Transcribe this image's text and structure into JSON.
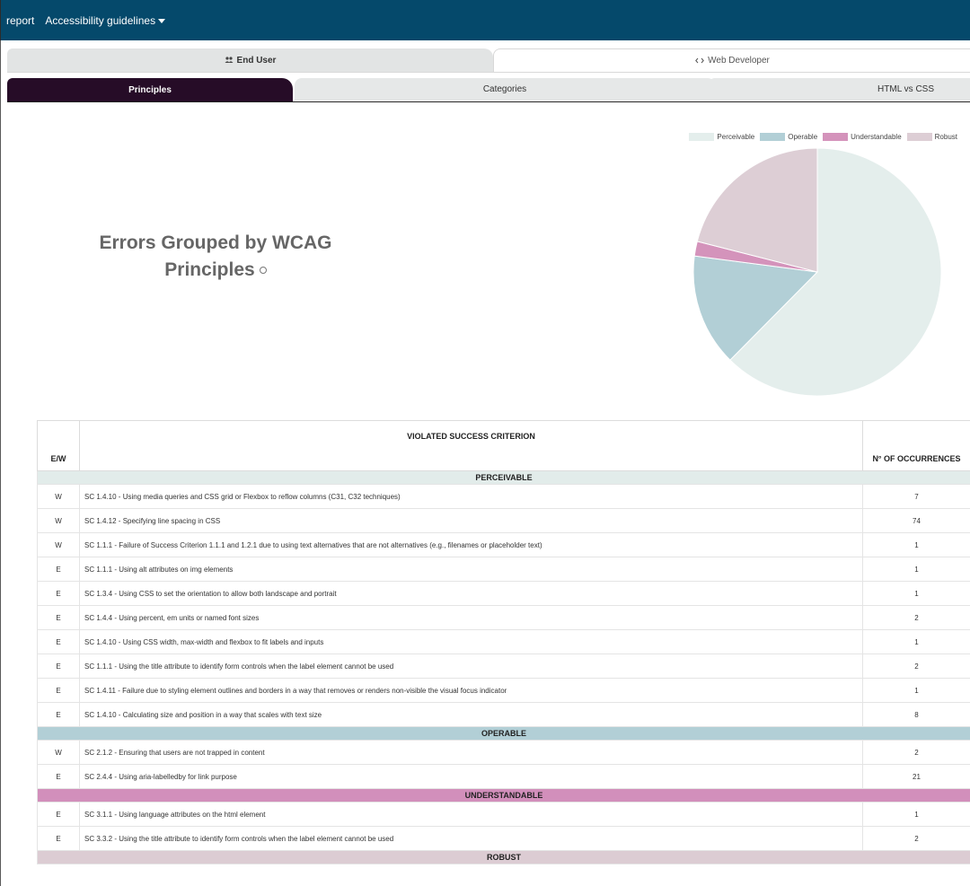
{
  "navbar": {
    "items": [
      "report",
      "Accessibility guidelines"
    ]
  },
  "audience_tabs": [
    {
      "icon": "users-icon",
      "label": "End User"
    },
    {
      "icon": "code-icon",
      "label": "Web Developer"
    }
  ],
  "analysis_tabs": [
    "Principles",
    "Categories",
    "HTML vs CSS"
  ],
  "heading": "Errors Grouped by WCAG Principles",
  "legend": [
    {
      "label": "Perceivable",
      "color": "#e4eeec"
    },
    {
      "label": "Operable",
      "color": "#b2cfd6"
    },
    {
      "label": "Understandable",
      "color": "#d493bb"
    },
    {
      "label": "Robust",
      "color": "#ddced5"
    }
  ],
  "chart_data": {
    "type": "pie",
    "labels": [
      "Perceivable",
      "Operable",
      "Understandable",
      "Robust"
    ],
    "values": [
      98,
      23,
      3,
      33
    ],
    "colors": [
      "#e4eeec",
      "#b2cfd6",
      "#d493bb",
      "#ddced5"
    ],
    "start": "top, clockwise"
  },
  "table": {
    "headers": [
      "E/W",
      "VIOLATED SUCCESS CRITERION",
      "N° OF OCCURRENCES"
    ],
    "groups": [
      {
        "name": "PERCEIVABLE",
        "color": "#e2ecea",
        "rows": [
          {
            "ew": "W",
            "criterion": "SC 1.4.10 - Using media queries and CSS grid or Flexbox to reflow columns (C31, C32 techniques)",
            "count": "7"
          },
          {
            "ew": "W",
            "criterion": "SC 1.4.12 - Specifying line spacing in CSS",
            "count": "74"
          },
          {
            "ew": "W",
            "criterion": "SC 1.1.1 - Failure of Success Criterion 1.1.1 and 1.2.1 due to using text alternatives that are not alternatives (e.g., filenames or placeholder text)",
            "count": "1"
          },
          {
            "ew": "E",
            "criterion": "SC 1.1.1 - Using alt attributes on img elements",
            "count": "1"
          },
          {
            "ew": "E",
            "criterion": "SC 1.3.4 - Using CSS to set the orientation to allow both landscape and portrait",
            "count": "1"
          },
          {
            "ew": "E",
            "criterion": "SC 1.4.4 - Using percent, em units or named font sizes",
            "count": "2"
          },
          {
            "ew": "E",
            "criterion": "SC 1.4.10 - Using CSS width, max-width and flexbox to fit labels and inputs",
            "count": "1"
          },
          {
            "ew": "E",
            "criterion": "SC 1.1.1 - Using the title attribute to identify form controls when the label element cannot be used",
            "count": "2"
          },
          {
            "ew": "E",
            "criterion": "SC 1.4.11 - Failure due to styling element outlines and borders in a way that removes or renders non-visible the visual focus indicator",
            "count": "1"
          },
          {
            "ew": "E",
            "criterion": "SC 1.4.10 - Calculating size and position in a way that scales with text size",
            "count": "8"
          }
        ]
      },
      {
        "name": "OPERABLE",
        "color": "#b2cfd6",
        "rows": [
          {
            "ew": "W",
            "criterion": "SC 2.1.2 - Ensuring that users are not trapped in content",
            "count": "2"
          },
          {
            "ew": "E",
            "criterion": "SC 2.4.4 - Using aria-labelledby for link purpose",
            "count": "21"
          }
        ]
      },
      {
        "name": "UNDERSTANDABLE",
        "color": "#d28fbb",
        "rows": [
          {
            "ew": "E",
            "criterion": "SC 3.1.1 - Using language attributes on the html element",
            "count": "1"
          },
          {
            "ew": "E",
            "criterion": "SC 3.3.2 - Using the title attribute to identify form controls when the label element cannot be used",
            "count": "2"
          }
        ]
      },
      {
        "name": "ROBUST",
        "color": "#dcccd3",
        "rows": []
      }
    ]
  }
}
